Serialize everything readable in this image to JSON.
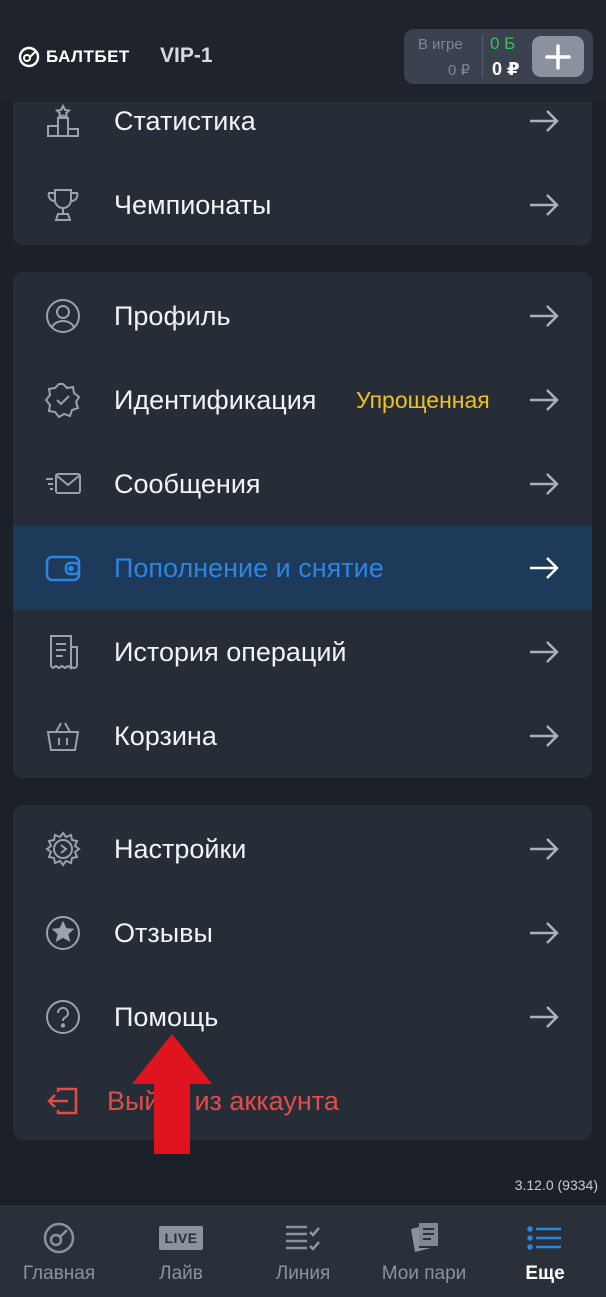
{
  "header": {
    "brand": "БАЛТБЕТ",
    "vip": "VIP-1",
    "balance": {
      "in_game_label": "В игре",
      "in_game_value": "0 ₽",
      "bonus_value": "0 Б",
      "main_value": "0 ₽"
    }
  },
  "menu_group_1": [
    {
      "label": "Статистика",
      "icon": "podium-icon"
    },
    {
      "label": "Чемпионаты",
      "icon": "trophy-icon"
    }
  ],
  "menu_group_2": [
    {
      "label": "Профиль",
      "icon": "user-circle-icon"
    },
    {
      "label": "Идентификация",
      "icon": "verified-badge-icon",
      "badge": "Упрощенная"
    },
    {
      "label": "Сообщения",
      "icon": "envelope-icon"
    },
    {
      "label": "Пополнение и снятие",
      "icon": "wallet-icon",
      "active": true
    },
    {
      "label": "История операций",
      "icon": "receipt-icon"
    },
    {
      "label": "Корзина",
      "icon": "basket-icon"
    }
  ],
  "menu_group_3": [
    {
      "label": "Настройки",
      "icon": "gear-icon"
    },
    {
      "label": "Отзывы",
      "icon": "star-circle-icon"
    },
    {
      "label": "Помощь",
      "icon": "question-circle-icon"
    }
  ],
  "logout_label": "Выйти из аккаунта",
  "version": "3.12.0 (9334)",
  "bottom_nav": [
    {
      "label": "Главная",
      "icon": "home-ball-icon"
    },
    {
      "label": "Лайв",
      "icon": "live-icon",
      "icon_text": "LIVE"
    },
    {
      "label": "Линия",
      "icon": "line-list-icon"
    },
    {
      "label": "Мои пари",
      "icon": "my-bets-icon"
    },
    {
      "label": "Еще",
      "icon": "menu-icon",
      "current": true
    }
  ],
  "colors": {
    "accent_blue": "#2a86e0",
    "badge_yellow": "#f0c21e",
    "logout_red": "#e24b4b",
    "bonus_green": "#3fbf5a",
    "annotation_red": "#e0141e"
  }
}
